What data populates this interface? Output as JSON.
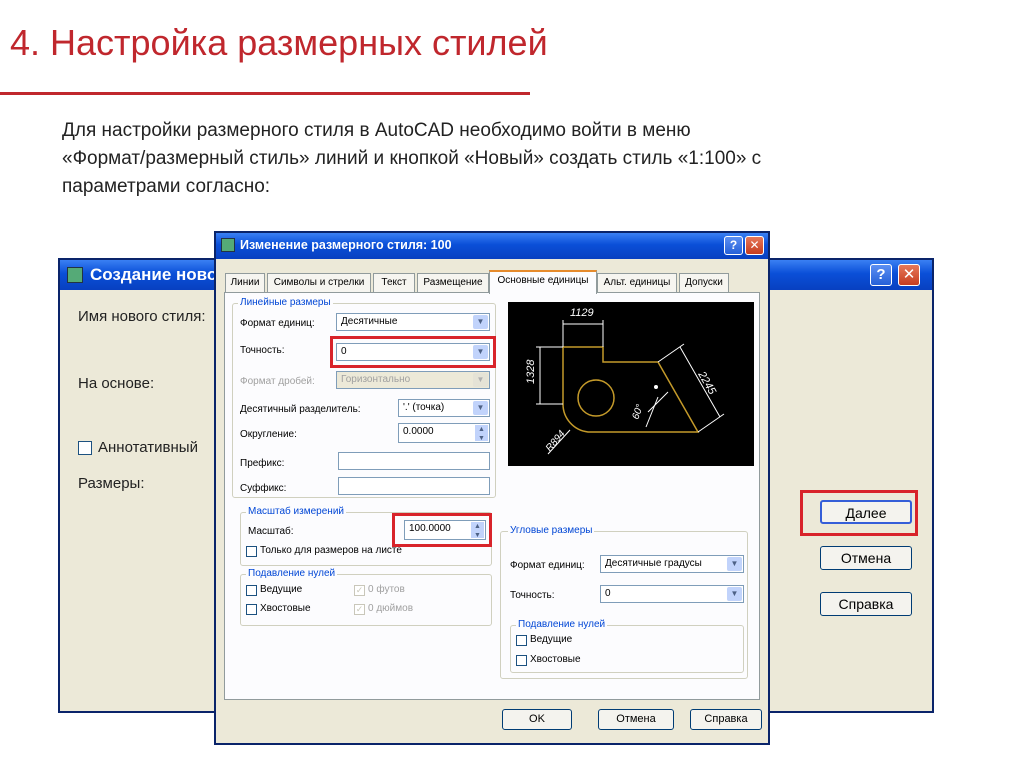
{
  "slide": {
    "title": "4. Настройка размерных стилей",
    "paragraph_lines": [
      "Для настройки размерного стиля в AutoCAD необходимо войти в меню",
      "«Формат/размерный стиль» линий и кнопкой «Новый» создать стиль «1:100» с",
      "параметрами согласно:"
    ]
  },
  "bg_dialog": {
    "title": "Создание новог",
    "help": "?",
    "close": "✕",
    "labels": {
      "new_style_name": "Имя нового стиля:",
      "based_on": "На основе:",
      "annotative": "Аннотативный",
      "dimensions": "Размеры:"
    },
    "buttons": {
      "next": "Далее",
      "cancel": "Отмена",
      "help": "Справка"
    }
  },
  "fg_dialog": {
    "title": "Изменение размерного стиля: 100",
    "tabs": [
      "Линии",
      "Символы и стрелки",
      "Текст",
      "Размещение",
      "Основные единицы",
      "Альт. единицы",
      "Допуски"
    ],
    "active_tab": 4,
    "linear": {
      "group_title": "Линейные размеры",
      "unit_format_label": "Формат единиц:",
      "unit_format_value": "Десятичные",
      "precision_label": "Точность:",
      "precision_value": "0",
      "fraction_format_label": "Формат дробей:",
      "fraction_format_value": "Горизонтально",
      "decimal_sep_label": "Десятичный разделитель:",
      "decimal_sep_value": "'.' (точка)",
      "rounding_label": "Округление:",
      "rounding_value": "0.0000",
      "prefix_label": "Префикс:",
      "suffix_label": "Суффикс:"
    },
    "scale": {
      "group_title": "Масштаб измерений",
      "scale_label": "Масштаб:",
      "scale_value": "100.0000",
      "layout_only": "Только для размеров на листе"
    },
    "zero_linear": {
      "group_title": "Подавление нулей",
      "leading": "Ведущие",
      "trailing": "Хвостовые",
      "feet": "0 футов",
      "inches": "0 дюймов"
    },
    "preview_labels": {
      "top": "1129",
      "left": "1328",
      "diag": "2245",
      "angle": "60°",
      "radius": "R894"
    },
    "angular": {
      "group_title": "Угловые размеры",
      "unit_format_label": "Формат единиц:",
      "unit_format_value": "Десятичные градусы",
      "precision_label": "Точность:",
      "precision_value": "0"
    },
    "zero_angular": {
      "group_title": "Подавление нулей",
      "leading": "Ведущие",
      "trailing": "Хвостовые"
    },
    "buttons": {
      "ok": "OK",
      "cancel": "Отмена",
      "help": "Справка"
    },
    "help": "?",
    "close": "✕"
  }
}
